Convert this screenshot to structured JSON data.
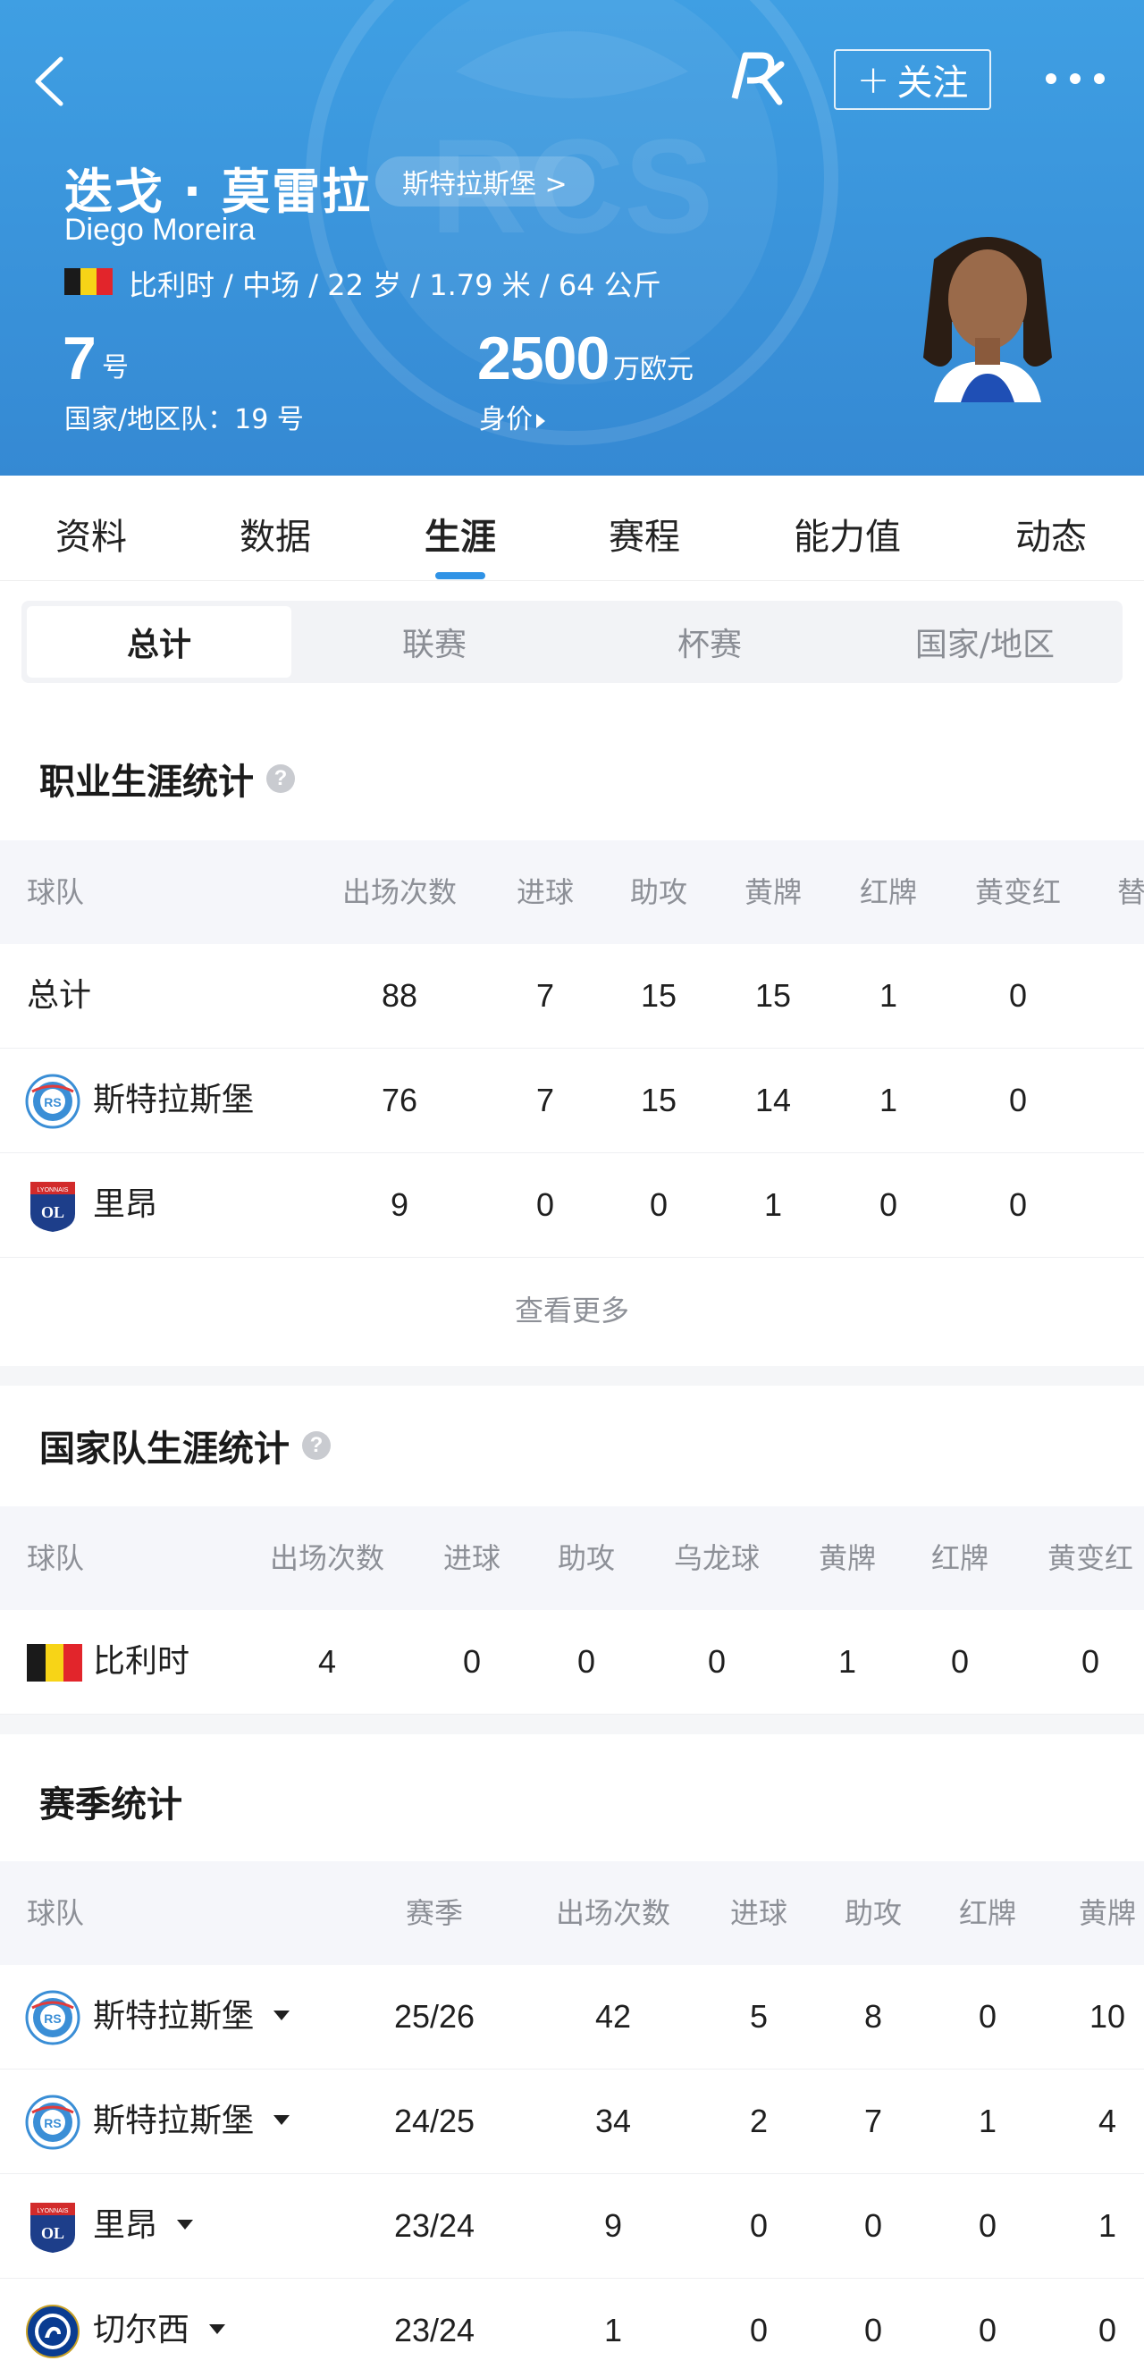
{
  "header": {
    "name_cn": "迭戈 · 莫雷拉",
    "name_en": "Diego Moreira",
    "club_link": "斯特拉斯堡 >",
    "follow_label": "关注",
    "info_line": "比利时 / 中场 / 22 岁 / 1.79 米 / 64 公斤",
    "shirt_number": "7",
    "shirt_unit": "号",
    "national_number": "国家/地区队：19 号",
    "market_value": "2500",
    "market_value_unit": "万欧元",
    "market_value_label": "身价",
    "colors": {
      "bg_top": "#3f9fe3",
      "bg_bottom": "#3589d3"
    }
  },
  "main_tabs": [
    "资料",
    "数据",
    "生涯",
    "赛程",
    "能力值",
    "动态"
  ],
  "main_tab_active": "生涯",
  "sub_tabs": [
    "总计",
    "联赛",
    "杯赛",
    "国家/地区"
  ],
  "sub_tab_active": "总计",
  "career": {
    "title": "职业生涯统计",
    "headers": [
      "球队",
      "出场次数",
      "进球",
      "助攻",
      "黄牌",
      "红牌",
      "黄变红",
      "替"
    ],
    "rows": [
      {
        "team": "总计",
        "logo": "",
        "cells": [
          "88",
          "7",
          "15",
          "15",
          "1",
          "0"
        ]
      },
      {
        "team": "斯特拉斯堡",
        "logo": "strasbourg-logo",
        "cells": [
          "76",
          "7",
          "15",
          "14",
          "1",
          "0"
        ]
      },
      {
        "team": "里昂",
        "logo": "lyon-logo",
        "cells": [
          "9",
          "0",
          "0",
          "1",
          "0",
          "0"
        ]
      }
    ],
    "more_label": "查看更多"
  },
  "national": {
    "title": "国家队生涯统计",
    "headers": [
      "球队",
      "出场次数",
      "进球",
      "助攻",
      "乌龙球",
      "黄牌",
      "红牌",
      "黄变红"
    ],
    "rows": [
      {
        "team": "比利时",
        "logo": "belgium-flag",
        "cells": [
          "4",
          "0",
          "0",
          "0",
          "1",
          "0",
          "0"
        ]
      }
    ]
  },
  "season": {
    "title": "赛季统计",
    "headers": [
      "球队",
      "赛季",
      "出场次数",
      "进球",
      "助攻",
      "红牌",
      "黄牌"
    ],
    "rows": [
      {
        "team": "斯特拉斯堡",
        "logo": "strasbourg-logo",
        "season": "25/26",
        "cells": [
          "42",
          "5",
          "8",
          "0",
          "10"
        ]
      },
      {
        "team": "斯特拉斯堡",
        "logo": "strasbourg-logo",
        "season": "24/25",
        "cells": [
          "34",
          "2",
          "7",
          "1",
          "4"
        ]
      },
      {
        "team": "里昂",
        "logo": "lyon-logo",
        "season": "23/24",
        "cells": [
          "9",
          "0",
          "0",
          "0",
          "1"
        ]
      },
      {
        "team": "切尔西",
        "logo": "chelsea-logo",
        "season": "23/24",
        "cells": [
          "1",
          "0",
          "0",
          "0",
          "0"
        ]
      }
    ]
  }
}
